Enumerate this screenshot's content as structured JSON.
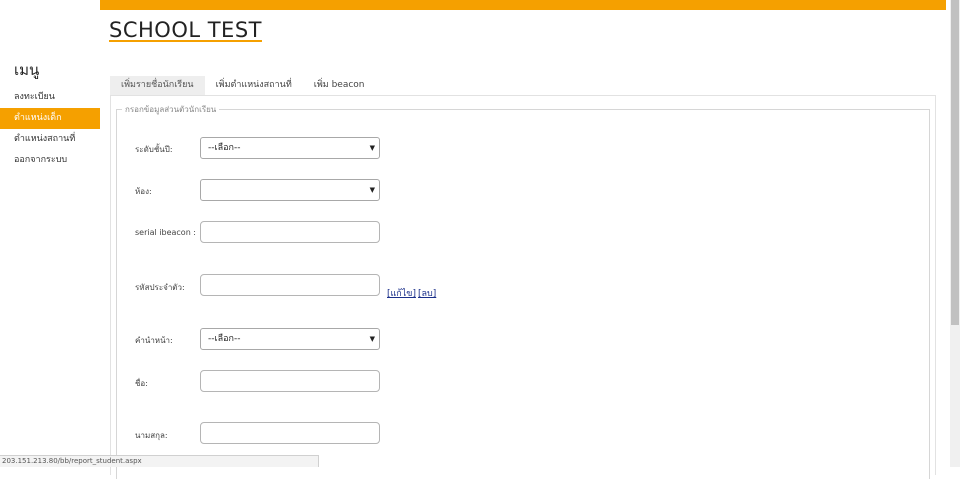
{
  "site": {
    "title": "SCHOOL TEST"
  },
  "sidebar": {
    "heading": "เมนู",
    "items": [
      {
        "label": "ลงทะเบียน"
      },
      {
        "label": "ตำแหน่งเด็ก"
      },
      {
        "label": "ตำแหน่งสถานที่"
      },
      {
        "label": "ออกจากระบบ"
      }
    ]
  },
  "tabs": [
    {
      "label": "เพิ่มรายชื่อนักเรียน"
    },
    {
      "label": "เพิ่มตำแหน่งสถานที่"
    },
    {
      "label": "เพิ่ม beacon"
    }
  ],
  "form": {
    "legend": "กรอกข้อมูลส่วนตัวนักเรียน",
    "grade": {
      "label": "ระดับชั้นปี:",
      "value": "--เลือก--"
    },
    "room": {
      "label": "ห้อง:",
      "value": ""
    },
    "serial": {
      "label": "serial ibeacon :",
      "value": ""
    },
    "student_id": {
      "label": "รหัสประจำตัว:",
      "value": ""
    },
    "edit_link": "[แก้ไข]",
    "delete_link": "[ลบ]",
    "prefix": {
      "label": "คำนำหน้า:",
      "value": "--เลือก--"
    },
    "first_name": {
      "label": "ชื่อ:",
      "value": ""
    },
    "last_name": {
      "label": "นามสกุล:",
      "value": ""
    }
  },
  "status": {
    "url": "203.151.213.80/bb/report_student.aspx"
  },
  "colors": {
    "accent": "#f5a000",
    "link": "#1a2f8a"
  }
}
